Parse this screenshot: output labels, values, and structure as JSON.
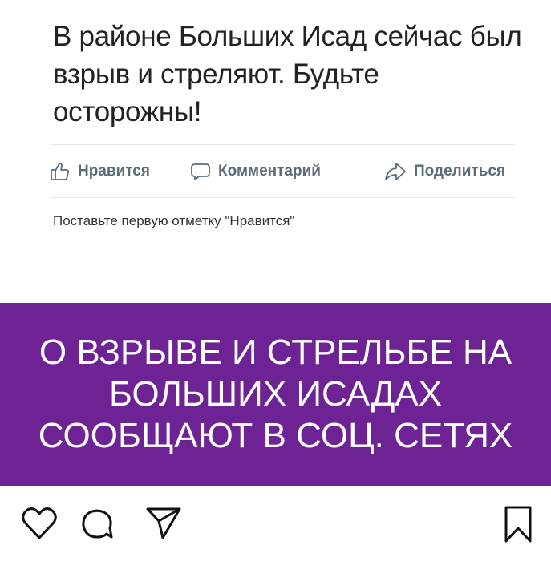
{
  "post": {
    "text": "В районе Больших Исад сейчас был взрыв и стреляют. Будьте осторожны!",
    "actions": {
      "like_label": "Нравится",
      "comment_label": "Комментарий",
      "share_label": "Поделиться"
    },
    "likes_prompt": "Поставьте первую отметку \"Нравится\""
  },
  "banner": {
    "line1": "О ВЗРЫВЕ И СТРЕЛЬБЕ НА",
    "line2": "БОЛЬШИХ ИСАДАХ",
    "line3": "СООБЩАЮТ В СОЦ. СЕТЯХ",
    "background": "#6e2395"
  },
  "toolbar": {
    "icons": [
      "heart-icon",
      "comment-bubble-icon",
      "paper-plane-icon",
      "bookmark-icon"
    ]
  },
  "colors": {
    "action_text": "#5b6b7a",
    "post_text": "#222222",
    "banner_bg": "#6e2395"
  }
}
